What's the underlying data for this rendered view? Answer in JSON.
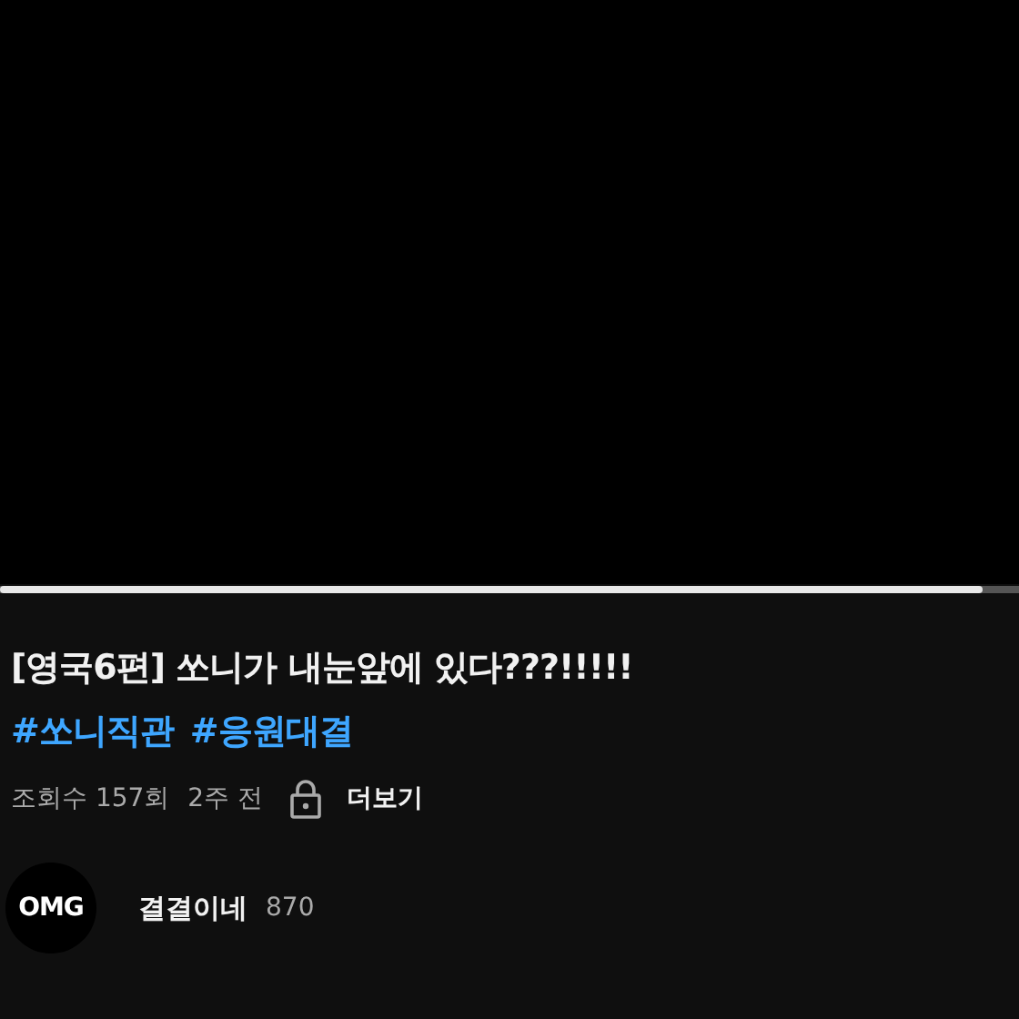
{
  "video": {
    "progress": {
      "level": 0.965
    }
  },
  "title": "[영국6편] 쏘니가 내눈앞에 있다???!!!!!",
  "hashtags": [
    "#쏘니직관",
    "#응원대결"
  ],
  "meta": {
    "views": "조회수 157회",
    "age": "2주 전",
    "more": "더보기"
  },
  "channel": {
    "avatar_text": "OMG",
    "name": "결결이네",
    "subscribers": "870"
  }
}
